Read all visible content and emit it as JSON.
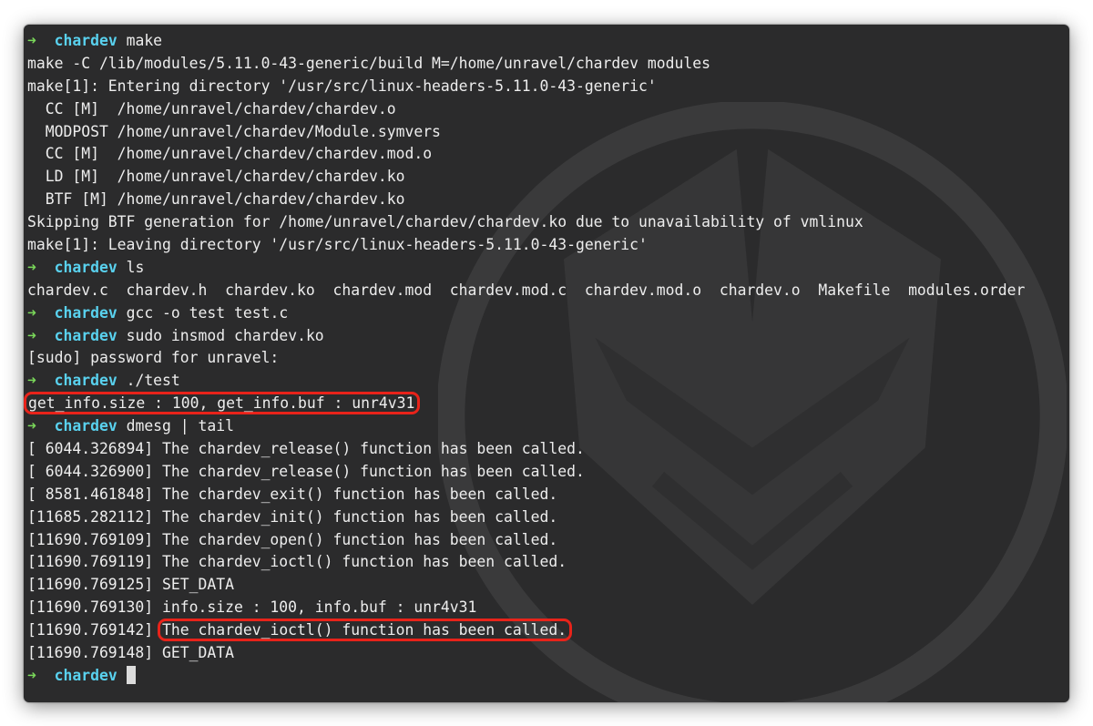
{
  "terminal": {
    "prompt_dir": "chardev",
    "lines": [
      {
        "type": "prompt",
        "cmd": "make"
      },
      {
        "type": "out",
        "text": "make -C /lib/modules/5.11.0-43-generic/build M=/home/unravel/chardev modules"
      },
      {
        "type": "out",
        "text": "make[1]: Entering directory '/usr/src/linux-headers-5.11.0-43-generic'"
      },
      {
        "type": "out",
        "text": "  CC [M]  /home/unravel/chardev/chardev.o"
      },
      {
        "type": "out",
        "text": "  MODPOST /home/unravel/chardev/Module.symvers"
      },
      {
        "type": "out",
        "text": "  CC [M]  /home/unravel/chardev/chardev.mod.o"
      },
      {
        "type": "out",
        "text": "  LD [M]  /home/unravel/chardev/chardev.ko"
      },
      {
        "type": "out",
        "text": "  BTF [M] /home/unravel/chardev/chardev.ko"
      },
      {
        "type": "out",
        "text": "Skipping BTF generation for /home/unravel/chardev/chardev.ko due to unavailability of vmlinux"
      },
      {
        "type": "out",
        "text": "make[1]: Leaving directory '/usr/src/linux-headers-5.11.0-43-generic'"
      },
      {
        "type": "prompt",
        "cmd": "ls"
      },
      {
        "type": "out",
        "text": "chardev.c  chardev.h  chardev.ko  chardev.mod  chardev.mod.c  chardev.mod.o  chardev.o  Makefile  modules.order"
      },
      {
        "type": "prompt",
        "cmd": "gcc -o test test.c"
      },
      {
        "type": "prompt",
        "cmd": "sudo insmod chardev.ko"
      },
      {
        "type": "out",
        "text": "[sudo] password for unravel:"
      },
      {
        "type": "prompt",
        "cmd": "./test"
      },
      {
        "type": "out_hl",
        "prefix": "",
        "text": "get_info.size : 100, get_info.buf : unr4v31"
      },
      {
        "type": "prompt",
        "cmd": "dmesg | tail"
      },
      {
        "type": "out",
        "text": "[ 6044.326894] The chardev_release() function has been called."
      },
      {
        "type": "out",
        "text": "[ 6044.326900] The chardev_release() function has been called."
      },
      {
        "type": "out",
        "text": "[ 8581.461848] The chardev_exit() function has been called."
      },
      {
        "type": "out",
        "text": "[11685.282112] The chardev_init() function has been called."
      },
      {
        "type": "out",
        "text": "[11690.769109] The chardev_open() function has been called."
      },
      {
        "type": "out",
        "text": "[11690.769119] The chardev_ioctl() function has been called."
      },
      {
        "type": "out",
        "text": "[11690.769125] SET_DATA"
      },
      {
        "type": "out",
        "text": "[11690.769130] info.size : 100, info.buf : unr4v31"
      },
      {
        "type": "out_hl",
        "prefix": "[11690.769142] ",
        "text": "The chardev_ioctl() function has been called."
      },
      {
        "type": "out",
        "text": "[11690.769148] GET_DATA"
      },
      {
        "type": "cursor"
      }
    ]
  },
  "colors": {
    "background": "#2b2b2c",
    "prompt_arrow": "#7ad85a",
    "prompt_dir": "#59d1ee",
    "text": "#ededed",
    "highlight_box": "#e8231a"
  },
  "icons": {
    "prompt_arrow": "arrow-right-icon",
    "watermark": "shield-eagle-logo"
  }
}
